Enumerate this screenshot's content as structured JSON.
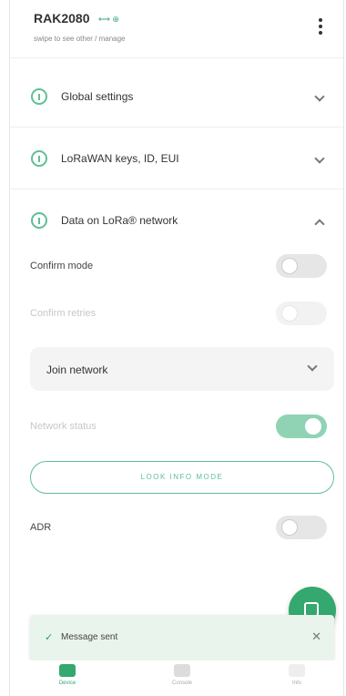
{
  "header": {
    "device_name": "RAK2080",
    "device_tag": "⟷ ⊕",
    "subtitle": "swipe to see other / manage"
  },
  "sections": [
    {
      "label": "Global settings",
      "expanded": false
    },
    {
      "label": "LoRaWAN keys, ID, EUI",
      "expanded": false
    },
    {
      "label": "Data on LoRa® network",
      "expanded": true
    }
  ],
  "settings": {
    "confirm_mode": {
      "label": "Confirm mode",
      "on": false
    },
    "confirm_retries": {
      "label": "Confirm retries",
      "on": false
    },
    "join_network": {
      "label": "Join network"
    },
    "network_status": {
      "label": "Network status",
      "on": true
    },
    "join_button": {
      "label": "LOOK INFO MODE"
    },
    "adr": {
      "label": "ADR",
      "on": false
    }
  },
  "snackbar": {
    "check_icon": "✓",
    "message": "Message sent",
    "close_icon": "✕"
  },
  "bottom_nav": {
    "items": [
      {
        "label": "Device",
        "icon": "device-icon",
        "active": true
      },
      {
        "label": "Console",
        "icon": "console-icon",
        "active": false
      },
      {
        "label": "Info",
        "icon": "info-icon",
        "active": false
      }
    ]
  },
  "colors": {
    "accent": "#5fbf96",
    "fab": "#34a86e",
    "snackbar_bg": "#e9f4ec"
  }
}
